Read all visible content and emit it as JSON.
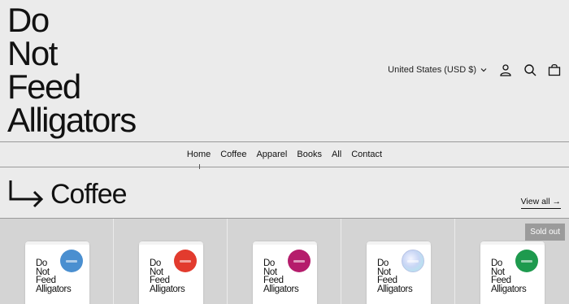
{
  "store": {
    "logo_lines": [
      "Do",
      "Not",
      "Feed",
      "Alligators"
    ]
  },
  "header": {
    "currency": "United States (USD $)",
    "icons": [
      "account-icon",
      "search-icon",
      "cart-icon"
    ]
  },
  "nav": {
    "items": [
      "Home",
      "Coffee",
      "Apparel",
      "Books",
      "All",
      "Contact"
    ],
    "active": "Home"
  },
  "collection": {
    "title": "Coffee",
    "view_all": "View all →"
  },
  "products": [
    {
      "bag_lines": [
        "Do",
        "Not",
        "Feed",
        "Alligators"
      ],
      "seal_color": "#4a8fd0",
      "badge": ""
    },
    {
      "bag_lines": [
        "Do",
        "Not",
        "Feed",
        "Alligators"
      ],
      "seal_color": "#e23b2e",
      "badge": ""
    },
    {
      "bag_lines": [
        "Do",
        "Not",
        "Feed",
        "Alligators"
      ],
      "seal_color": "#b51d6c",
      "badge": ""
    },
    {
      "bag_lines": [
        "Do",
        "Not",
        "Feed",
        "Alligators"
      ],
      "seal_color": "holographic",
      "badge": ""
    },
    {
      "bag_lines": [
        "Do",
        "Not",
        "Feed",
        "Alligators"
      ],
      "seal_color": "#1e9a4e",
      "badge": "Sold out"
    }
  ],
  "colors": {
    "background": "#ebebeb",
    "product_bg": "#d4d4d4",
    "badge_bg": "#9b9b9b",
    "text": "#111111"
  }
}
